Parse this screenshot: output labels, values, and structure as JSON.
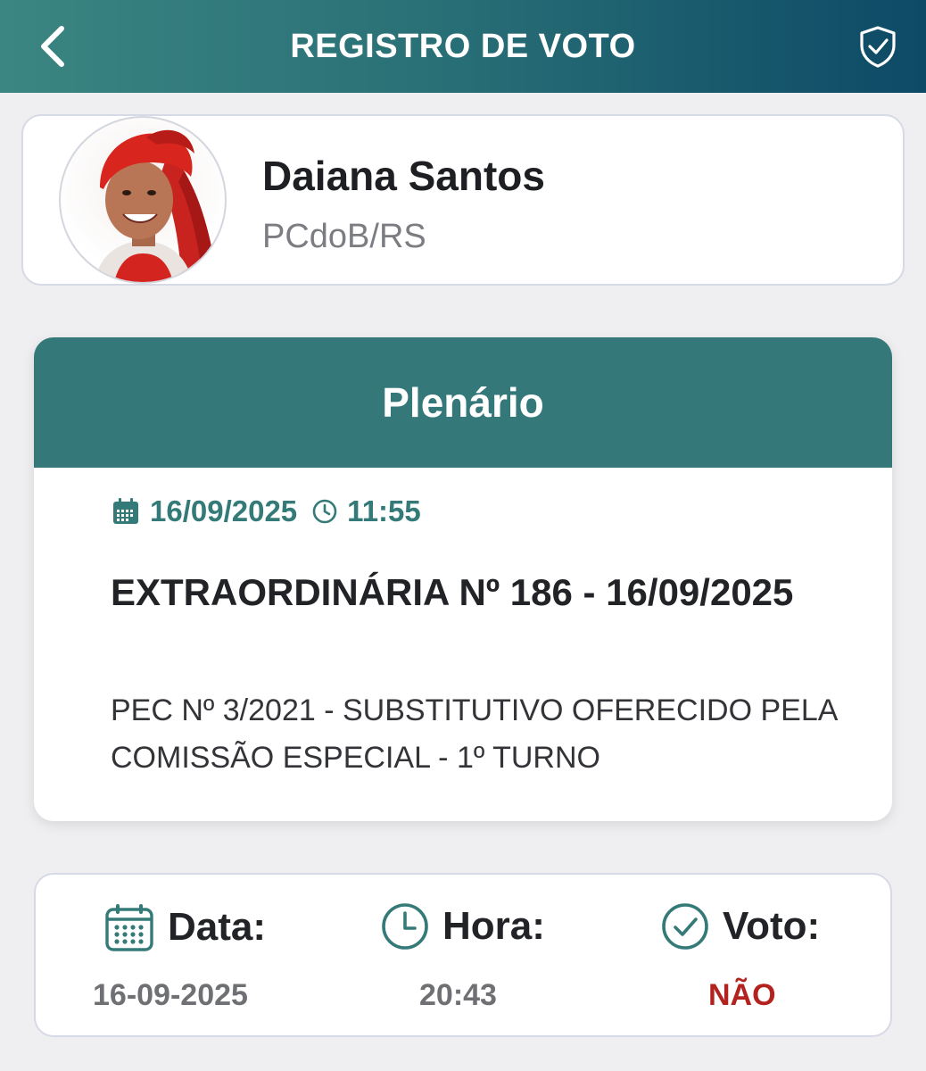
{
  "header": {
    "title": "REGISTRO DE VOTO",
    "back_icon": "chevron-left-icon",
    "shield_icon": "shield-check-icon"
  },
  "deputy": {
    "name": "Daiana Santos",
    "party": "PCdoB/RS"
  },
  "session": {
    "title": "Plenário",
    "date": "16/09/2025",
    "time": "11:55",
    "name": "EXTRAORDINÁRIA Nº 186 - 16/09/2025",
    "description": "PEC Nº 3/2021 - SUBSTITUTIVO OFERECIDO PELA COMISSÃO ESPECIAL - 1º TURNO"
  },
  "vote": {
    "date_label": "Data:",
    "date_value": "16-09-2025",
    "time_label": "Hora:",
    "time_value": "20:43",
    "vote_label": "Voto:",
    "vote_value": "NÃO"
  },
  "colors": {
    "header_start": "#3b8582",
    "header_end": "#0d4a66",
    "teal": "#35787a",
    "vote_no": "#b3221e"
  }
}
